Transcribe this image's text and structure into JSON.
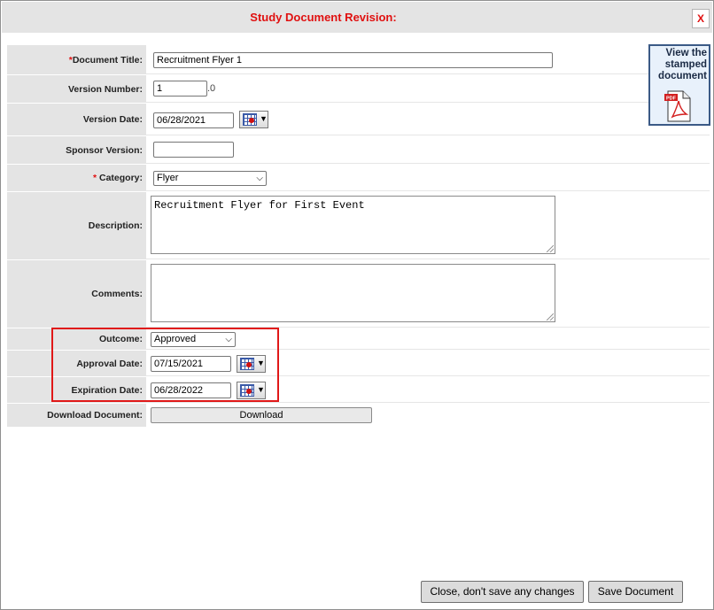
{
  "dialog": {
    "title": "Study Document Revision:",
    "close_label": "X"
  },
  "stamped": {
    "label": "View the stamped document",
    "icon": "pdf-icon"
  },
  "fields": {
    "document_title": {
      "required_mark": "*",
      "label": "Document Title:",
      "value": "Recruitment Flyer 1"
    },
    "version_number": {
      "label": "Version Number:",
      "value": "1",
      "suffix": ".0"
    },
    "version_date": {
      "label": "Version Date:",
      "value": "06/28/2021"
    },
    "sponsor_version": {
      "label": "Sponsor Version:",
      "value": ""
    },
    "category": {
      "required_mark": "*",
      "label": "Category:",
      "value": "Flyer"
    },
    "description": {
      "label": "Description:",
      "value": "Recruitment Flyer for First Event"
    },
    "comments": {
      "label": "Comments:",
      "value": ""
    },
    "outcome": {
      "label": "Outcome:",
      "value": "Approved"
    },
    "approval_date": {
      "label": "Approval Date:",
      "value": "07/15/2021"
    },
    "expiration_date": {
      "label": "Expiration Date:",
      "value": "06/28/2022"
    },
    "download_document": {
      "label": "Download Document:",
      "button": "Download"
    }
  },
  "footer": {
    "close_button": "Close, don't save any changes",
    "save_button": "Save Document"
  },
  "colors": {
    "title": "#e01010",
    "highlight": "#e01818",
    "label_bg": "#e4e4e4"
  }
}
